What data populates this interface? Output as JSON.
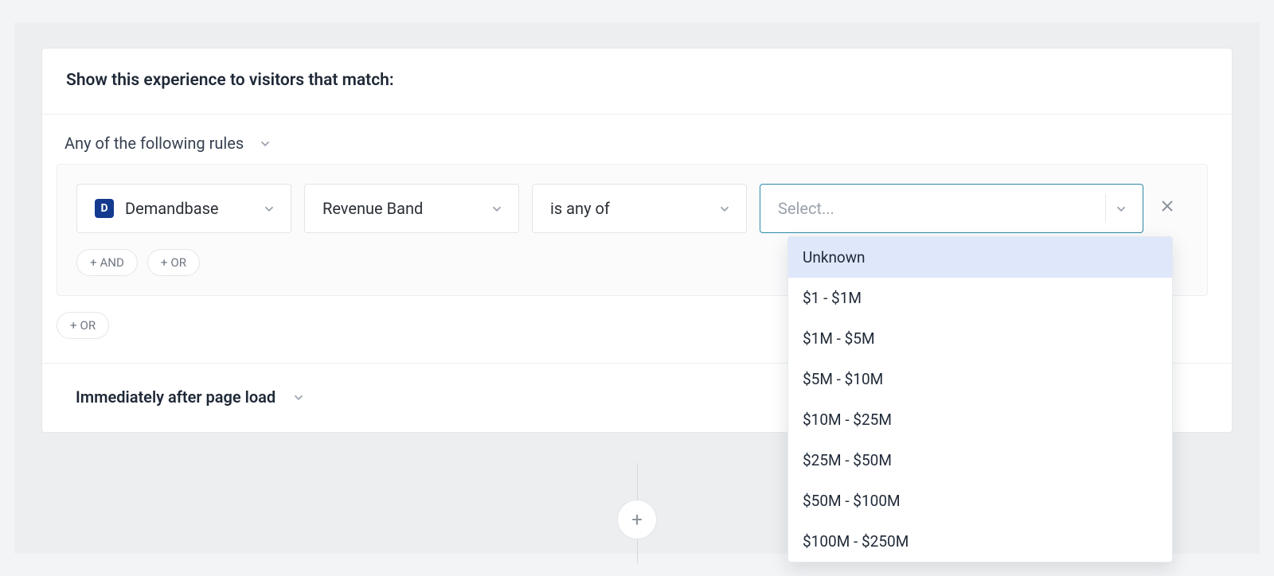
{
  "header": {
    "title": "Show this experience to visitors that match:"
  },
  "match": {
    "mode_label": "Any of the following rules"
  },
  "rule": {
    "integration_label": "Demandbase",
    "field_label": "Revenue Band",
    "operator_label": "is any of",
    "value_placeholder": "Select..."
  },
  "buttons": {
    "and_label": "AND",
    "or_label": "OR"
  },
  "timing": {
    "label": "Immediately after page load"
  },
  "dropdown": {
    "options": [
      "Unknown",
      "$1 - $1M",
      "$1M - $5M",
      "$5M - $10M",
      "$10M - $25M",
      "$25M - $50M",
      "$50M - $100M",
      "$100M - $250M"
    ],
    "highlighted_index": 0
  },
  "icons": {
    "integration_badge": "D"
  }
}
